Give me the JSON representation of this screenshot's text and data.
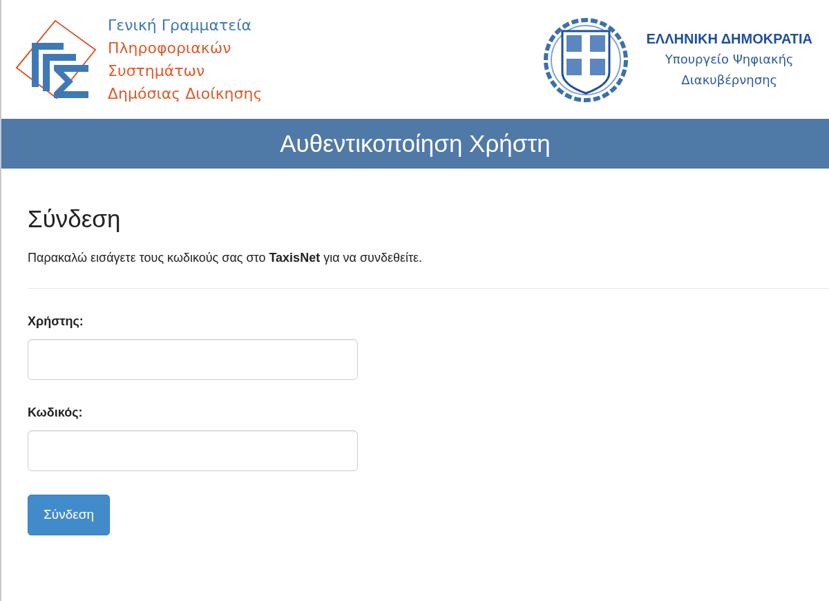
{
  "header": {
    "left_logo": {
      "lines": [
        {
          "text": "Γενική Γραμματεία",
          "color": "#3f79b5"
        },
        {
          "text": "Πληροφοριακών",
          "color": "#e05a2b"
        },
        {
          "text": "Συστημάτων",
          "color": "#e05a2b"
        },
        {
          "text": "Δημόσιας Διοίκησης",
          "color": "#e05a2b"
        }
      ]
    },
    "right_logo": {
      "title": "ΕΛΛΗΝΙΚΗ ΔΗΜΟΚΡΑΤΙΑ",
      "subtitle_lines": [
        "Υπουργείο Ψηφιακής",
        "Διακυβέρνησης"
      ]
    }
  },
  "banner": {
    "title": "Αυθεντικοποίηση Χρήστη"
  },
  "login": {
    "heading": "Σύνδεση",
    "intro": "Παρακαλώ εισάγετε τους κωδικούς σας στο **TaxisNet** για να συνδεθείτε.",
    "fields": [
      {
        "label": "Χρήστης:"
      },
      {
        "label": "Κωδικός:"
      }
    ],
    "submit": "Σύνδεση"
  }
}
